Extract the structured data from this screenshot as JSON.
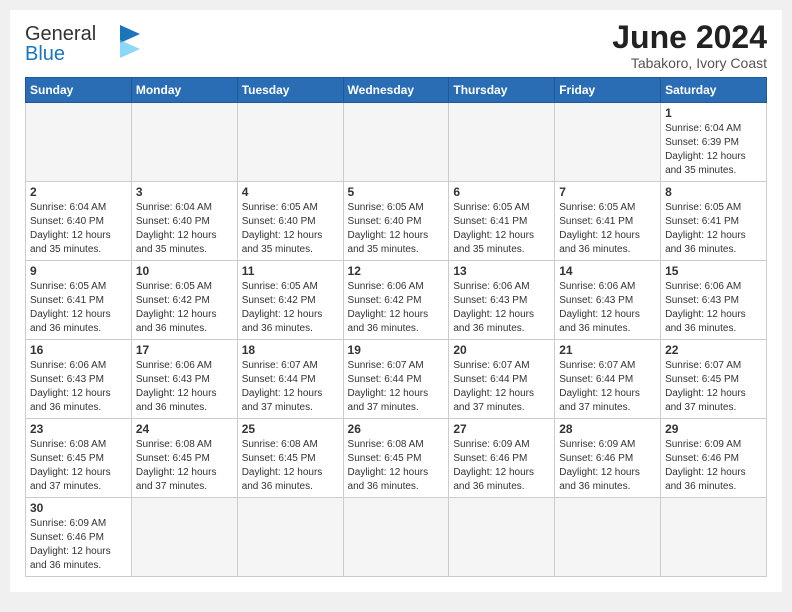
{
  "header": {
    "logo": {
      "general": "General",
      "blue": "Blue"
    },
    "title": "June 2024",
    "location": "Tabakoro, Ivory Coast"
  },
  "weekdays": [
    "Sunday",
    "Monday",
    "Tuesday",
    "Wednesday",
    "Thursday",
    "Friday",
    "Saturday"
  ],
  "weeks": [
    [
      {
        "day": null,
        "info": null
      },
      {
        "day": null,
        "info": null
      },
      {
        "day": null,
        "info": null
      },
      {
        "day": null,
        "info": null
      },
      {
        "day": null,
        "info": null
      },
      {
        "day": null,
        "info": null
      },
      {
        "day": "1",
        "info": "Sunrise: 6:04 AM\nSunset: 6:39 PM\nDaylight: 12 hours\nand 35 minutes."
      }
    ],
    [
      {
        "day": "2",
        "info": "Sunrise: 6:04 AM\nSunset: 6:40 PM\nDaylight: 12 hours\nand 35 minutes."
      },
      {
        "day": "3",
        "info": "Sunrise: 6:04 AM\nSunset: 6:40 PM\nDaylight: 12 hours\nand 35 minutes."
      },
      {
        "day": "4",
        "info": "Sunrise: 6:05 AM\nSunset: 6:40 PM\nDaylight: 12 hours\nand 35 minutes."
      },
      {
        "day": "5",
        "info": "Sunrise: 6:05 AM\nSunset: 6:40 PM\nDaylight: 12 hours\nand 35 minutes."
      },
      {
        "day": "6",
        "info": "Sunrise: 6:05 AM\nSunset: 6:41 PM\nDaylight: 12 hours\nand 35 minutes."
      },
      {
        "day": "7",
        "info": "Sunrise: 6:05 AM\nSunset: 6:41 PM\nDaylight: 12 hours\nand 36 minutes."
      },
      {
        "day": "8",
        "info": "Sunrise: 6:05 AM\nSunset: 6:41 PM\nDaylight: 12 hours\nand 36 minutes."
      }
    ],
    [
      {
        "day": "9",
        "info": "Sunrise: 6:05 AM\nSunset: 6:41 PM\nDaylight: 12 hours\nand 36 minutes."
      },
      {
        "day": "10",
        "info": "Sunrise: 6:05 AM\nSunset: 6:42 PM\nDaylight: 12 hours\nand 36 minutes."
      },
      {
        "day": "11",
        "info": "Sunrise: 6:05 AM\nSunset: 6:42 PM\nDaylight: 12 hours\nand 36 minutes."
      },
      {
        "day": "12",
        "info": "Sunrise: 6:06 AM\nSunset: 6:42 PM\nDaylight: 12 hours\nand 36 minutes."
      },
      {
        "day": "13",
        "info": "Sunrise: 6:06 AM\nSunset: 6:43 PM\nDaylight: 12 hours\nand 36 minutes."
      },
      {
        "day": "14",
        "info": "Sunrise: 6:06 AM\nSunset: 6:43 PM\nDaylight: 12 hours\nand 36 minutes."
      },
      {
        "day": "15",
        "info": "Sunrise: 6:06 AM\nSunset: 6:43 PM\nDaylight: 12 hours\nand 36 minutes."
      }
    ],
    [
      {
        "day": "16",
        "info": "Sunrise: 6:06 AM\nSunset: 6:43 PM\nDaylight: 12 hours\nand 36 minutes."
      },
      {
        "day": "17",
        "info": "Sunrise: 6:06 AM\nSunset: 6:43 PM\nDaylight: 12 hours\nand 36 minutes."
      },
      {
        "day": "18",
        "info": "Sunrise: 6:07 AM\nSunset: 6:44 PM\nDaylight: 12 hours\nand 37 minutes."
      },
      {
        "day": "19",
        "info": "Sunrise: 6:07 AM\nSunset: 6:44 PM\nDaylight: 12 hours\nand 37 minutes."
      },
      {
        "day": "20",
        "info": "Sunrise: 6:07 AM\nSunset: 6:44 PM\nDaylight: 12 hours\nand 37 minutes."
      },
      {
        "day": "21",
        "info": "Sunrise: 6:07 AM\nSunset: 6:44 PM\nDaylight: 12 hours\nand 37 minutes."
      },
      {
        "day": "22",
        "info": "Sunrise: 6:07 AM\nSunset: 6:45 PM\nDaylight: 12 hours\nand 37 minutes."
      }
    ],
    [
      {
        "day": "23",
        "info": "Sunrise: 6:08 AM\nSunset: 6:45 PM\nDaylight: 12 hours\nand 37 minutes."
      },
      {
        "day": "24",
        "info": "Sunrise: 6:08 AM\nSunset: 6:45 PM\nDaylight: 12 hours\nand 37 minutes."
      },
      {
        "day": "25",
        "info": "Sunrise: 6:08 AM\nSunset: 6:45 PM\nDaylight: 12 hours\nand 36 minutes."
      },
      {
        "day": "26",
        "info": "Sunrise: 6:08 AM\nSunset: 6:45 PM\nDaylight: 12 hours\nand 36 minutes."
      },
      {
        "day": "27",
        "info": "Sunrise: 6:09 AM\nSunset: 6:46 PM\nDaylight: 12 hours\nand 36 minutes."
      },
      {
        "day": "28",
        "info": "Sunrise: 6:09 AM\nSunset: 6:46 PM\nDaylight: 12 hours\nand 36 minutes."
      },
      {
        "day": "29",
        "info": "Sunrise: 6:09 AM\nSunset: 6:46 PM\nDaylight: 12 hours\nand 36 minutes."
      }
    ],
    [
      {
        "day": "30",
        "info": "Sunrise: 6:09 AM\nSunset: 6:46 PM\nDaylight: 12 hours\nand 36 minutes."
      },
      {
        "day": null,
        "info": null
      },
      {
        "day": null,
        "info": null
      },
      {
        "day": null,
        "info": null
      },
      {
        "day": null,
        "info": null
      },
      {
        "day": null,
        "info": null
      },
      {
        "day": null,
        "info": null
      }
    ]
  ]
}
